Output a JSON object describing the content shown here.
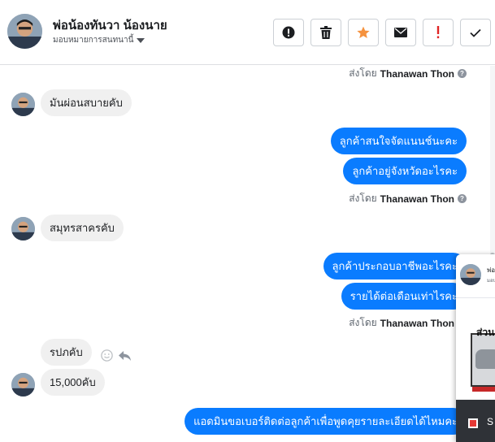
{
  "header": {
    "name": "พ่อน้องทันวา น้องนาย",
    "assign_label": "มอบหมายการสนทนานี้",
    "actions": [
      {
        "name": "report-button",
        "icon": "exclamation-circle-icon"
      },
      {
        "name": "delete-button",
        "icon": "trash-icon"
      },
      {
        "name": "star-button",
        "icon": "star-icon"
      },
      {
        "name": "mark-unread-button",
        "icon": "envelope-icon"
      },
      {
        "name": "spam-button",
        "icon": "exclamation-icon"
      },
      {
        "name": "done-button",
        "icon": "checkmark-icon"
      }
    ]
  },
  "colors": {
    "outgoing_bubble": "#0a7cff",
    "incoming_bubble": "#f0f0f0",
    "star": "#f5923e",
    "spam_icon": "#e02424"
  },
  "sender_prefix": "ส่งโดย",
  "sender_name": "Thanawan Thon",
  "messages": {
    "m1": "มันผ่อนสบายคับ",
    "m2": "ลูกค้าสนใจจัดแนนช์นะคะ",
    "m3": "ลูกค้าอยู่จังหวัดอะไรคะ",
    "m4": "สมุทรสาครคับ",
    "m5": "ลูกค้าประกอบอาชีพอะไรคะ",
    "m6": "รายได้ต่อเดือนเท่าไรคะ",
    "m7": "รปภคับ",
    "m8": "15,000คับ",
    "m9": "แอดมินขอเบอร์ติดต่อลูกค้าเพื่อพูดคุยรายละเอียดได้ไหมคะ"
  },
  "popup": {
    "title": "พ่อ",
    "subtitle": "มอบ",
    "image_text": "ส่วน",
    "bottom_text": "S"
  }
}
